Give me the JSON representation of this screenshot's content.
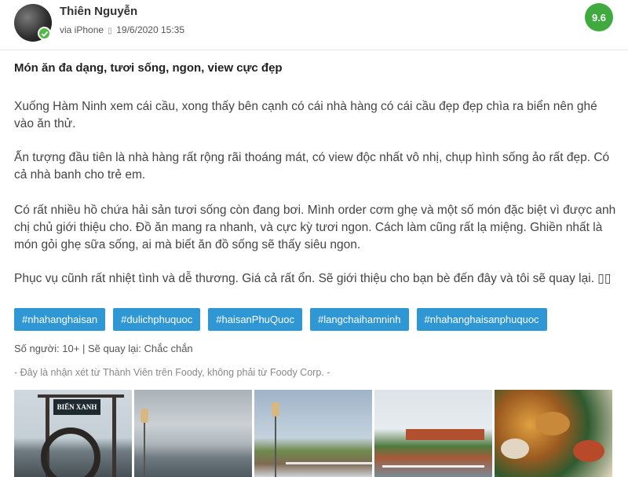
{
  "user": {
    "name": "Thiên Nguyễn",
    "via": "via iPhone",
    "separator": "▯",
    "date": "19/6/2020 15:35"
  },
  "score": "9.6",
  "review": {
    "title": "Món ăn đa dạng, tươi sống, ngon, view cực đẹp",
    "paragraphs": [
      "Xuống Hàm Ninh xem cái cầu, xong thấy bên cạnh có cái nhà hàng có cái cầu đẹp đẹp chìa ra biển nên ghé vào ăn thử.",
      "Ấn tượng đầu tiên là nhà hàng rất rộng rãi thoáng mát, có view độc nhất vô nhị, chụp hình sống ảo rất đẹp. Có cả nhà banh cho trẻ em.",
      "Có rất nhiều hồ chứa hải sản tươi sống còn đang bơi. Mình order cơm ghẹ và một số món đặc biệt vì được anh chị chủ giới thiệu cho. Đồ ăn mang ra nhanh, và cực kỳ tươi ngon. Cách làm cũng rất lạ miệng. Ghiền nhất là món gỏi ghẹ sữa sống, ai mà biết ăn đồ sống sẽ thấy siêu ngon.",
      "Phục vụ cũnh rất nhiệt tình và dễ thương. Giá cả rất ổn. Sẽ giới thiệu cho bạn bè đến đây và tôi sẽ quay lại. ▯▯"
    ]
  },
  "tags": [
    "#nhahanghaisan",
    "#dulichphuquoc",
    "#haisanPhuQuoc",
    "#langchaihamninh",
    "#nhahanghaisanphuquoc"
  ],
  "info": "Số người: 10+ | Sẽ quay lại: Chắc chắn",
  "disclaimer": "- Đây là nhận xét từ Thành Viên trên Foody, không phải từ Foody Corp. -",
  "photos": {
    "sign_text": "BIỂN XANH"
  },
  "colors": {
    "score_bg": "#3fab3f",
    "tag_bg": "#2f97d4",
    "verified_badge": "#52b848"
  }
}
